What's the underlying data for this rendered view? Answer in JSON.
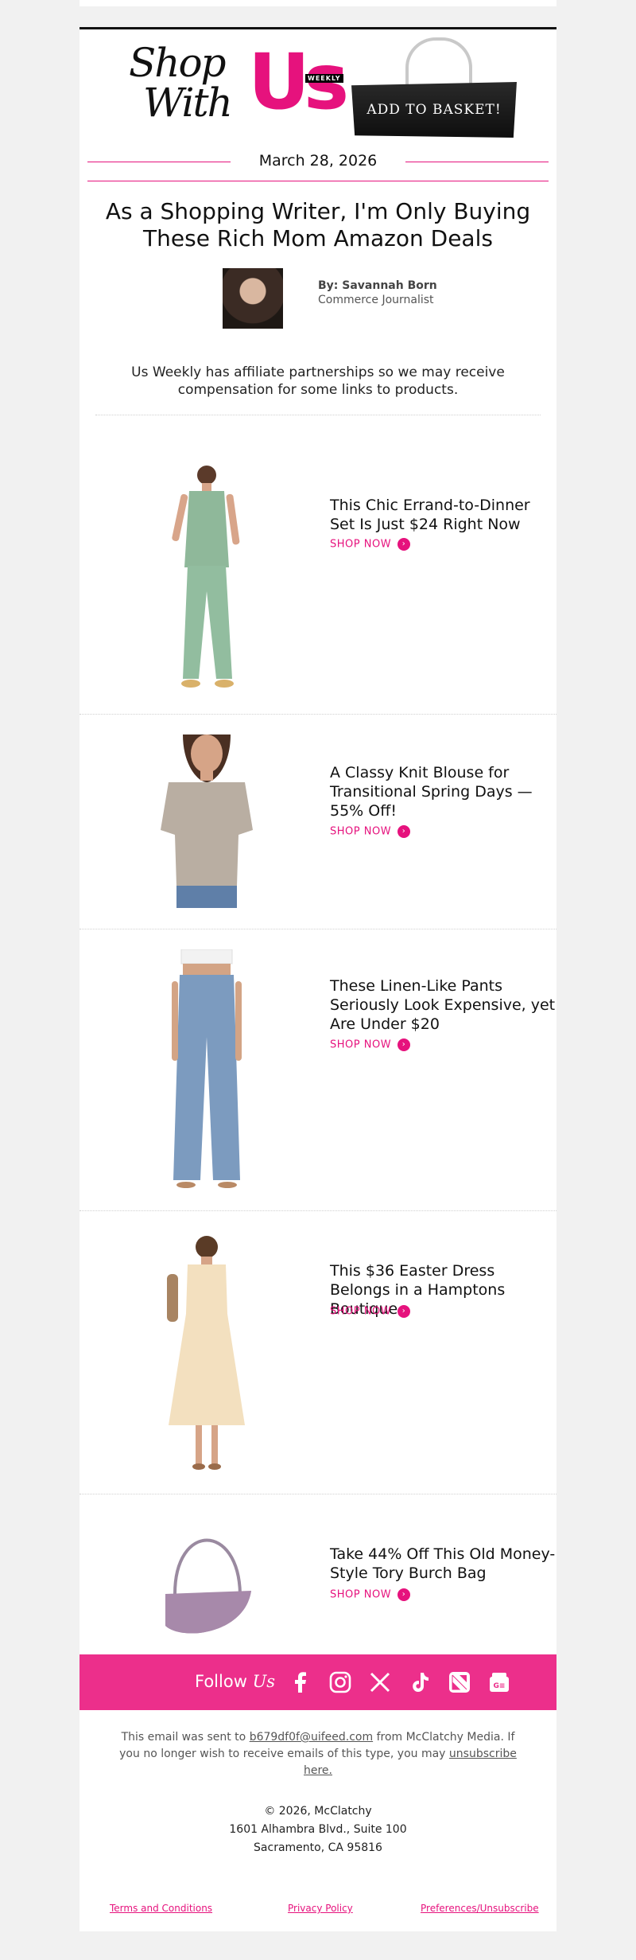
{
  "brand": {
    "logo_line1": "Shop",
    "logo_line2": "With",
    "logo_us": "Us",
    "logo_weekly": "WEEKLY",
    "basket_label": "ADD TO BASKET!"
  },
  "date": "March 28, 2026",
  "headline": "As a Shopping Writer, I'm Only Buying These Rich Mom Amazon Deals",
  "author": {
    "by": "By: Savannah Born",
    "role": "Commerce Journalist"
  },
  "disclaimer": "Us Weekly has affiliate partnerships so we may receive compensation for some links to products.",
  "products": [
    {
      "title": "This Chic Errand-to-Dinner Set Is Just $24 Right Now",
      "cta": "SHOP NOW"
    },
    {
      "title": "A Classy Knit Blouse for Transitional Spring Days — 55% Off!",
      "cta": "SHOP NOW"
    },
    {
      "title": "These Linen-Like Pants Seriously Look Expensive, yet Are Under $20",
      "cta": "SHOP NOW"
    },
    {
      "title": "This $36 Easter Dress Belongs in a Hamptons Boutique",
      "cta": "SHOP NOW"
    },
    {
      "title": "Take 44% Off This Old Money-Style Tory Burch Bag",
      "cta": "SHOP NOW"
    }
  ],
  "follow": {
    "label_pre": "Follow",
    "label_us": "Us",
    "icons": [
      "facebook-icon",
      "instagram-icon",
      "x-icon",
      "tiktok-icon",
      "apple-news-icon",
      "google-news-icon"
    ]
  },
  "footer": {
    "note_pre": "This email was sent to",
    "email": "b679df0f@uifeed.com",
    "note_mid": "from McClatchy Media. If you no longer wish to receive emails of this type, you may",
    "unsubscribe": "unsubscribe here.",
    "copyright": "© 2026, McClatchy",
    "address1": "1601 Alhambra Blvd., Suite 100",
    "address2": "Sacramento, CA 95816",
    "links": [
      "Terms and Conditions",
      "Privacy Policy",
      "Preferences/Unsubscribe"
    ]
  },
  "colors": {
    "accent": "#e6127d",
    "follow_bar": "#ec2f8b",
    "background": "#f1f1f1"
  }
}
